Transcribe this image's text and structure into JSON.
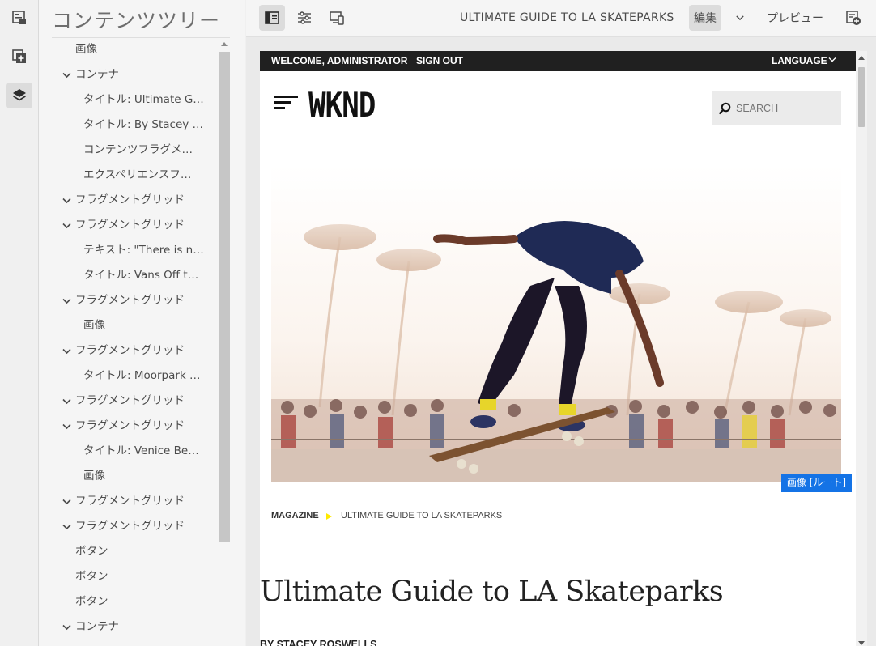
{
  "left_rail": {
    "items": [
      {
        "icon": "page-info-icon"
      },
      {
        "icon": "add-component-icon"
      },
      {
        "icon": "layers-icon"
      }
    ]
  },
  "panel": {
    "title": "コンテンツツリー",
    "tree": [
      {
        "label": "画像",
        "level": 1,
        "expandable": false
      },
      {
        "label": "コンテナ",
        "level": 0,
        "expandable": true
      },
      {
        "label": "タイトル: Ultimate G…",
        "level": 2,
        "expandable": false
      },
      {
        "label": "タイトル: By Stacey …",
        "level": 2,
        "expandable": false
      },
      {
        "label": "コンテンツフラグメ…",
        "level": 2,
        "expandable": false
      },
      {
        "label": "エクスペリエンスフ…",
        "level": 2,
        "expandable": false
      },
      {
        "label": "フラグメントグリッド",
        "level": 0,
        "expandable": true
      },
      {
        "label": "フラグメントグリッド",
        "level": 0,
        "expandable": true
      },
      {
        "label": "テキスト: \"There is n…",
        "level": 2,
        "expandable": false
      },
      {
        "label": "タイトル: Vans Off t…",
        "level": 2,
        "expandable": false
      },
      {
        "label": "フラグメントグリッド",
        "level": 0,
        "expandable": true
      },
      {
        "label": "画像",
        "level": 2,
        "expandable": false
      },
      {
        "label": "フラグメントグリッド",
        "level": 0,
        "expandable": true
      },
      {
        "label": "タイトル: Moorpark …",
        "level": 2,
        "expandable": false
      },
      {
        "label": "フラグメントグリッド",
        "level": 0,
        "expandable": true
      },
      {
        "label": "フラグメントグリッド",
        "level": 0,
        "expandable": true
      },
      {
        "label": "タイトル: Venice Be…",
        "level": 2,
        "expandable": false
      },
      {
        "label": "画像",
        "level": 2,
        "expandable": false
      },
      {
        "label": "フラグメントグリッド",
        "level": 0,
        "expandable": true
      },
      {
        "label": "フラグメントグリッド",
        "level": 0,
        "expandable": true
      },
      {
        "label": "ボタン",
        "level": 1,
        "expandable": false
      },
      {
        "label": "ボタン",
        "level": 1,
        "expandable": false
      },
      {
        "label": "ボタン",
        "level": 1,
        "expandable": false
      },
      {
        "label": "コンテナ",
        "level": 0,
        "expandable": true
      }
    ]
  },
  "toolbar": {
    "page_name": "ULTIMATE GUIDE TO LA SKATEPARKS",
    "mode_label": "編集",
    "preview_label": "プレビュー"
  },
  "site": {
    "topbar": {
      "welcome": "WELCOME, ADMINISTRATOR",
      "sign_out": "SIGN OUT",
      "language": "LANGUAGE"
    },
    "logo": "WKND",
    "search_placeholder": "SEARCH",
    "hero_badge": "画像 [ルート]",
    "breadcrumb": [
      "MAGAZINE",
      "ULTIMATE GUIDE TO LA SKATEPARKS"
    ],
    "article_title": "Ultimate Guide to LA Skateparks",
    "byline": "BY STACEY ROSWELLS"
  },
  "colors": {
    "accent_blue": "#1473e6",
    "breadcrumb_arrow": "#ffea00",
    "topbar_bg": "#202020"
  }
}
